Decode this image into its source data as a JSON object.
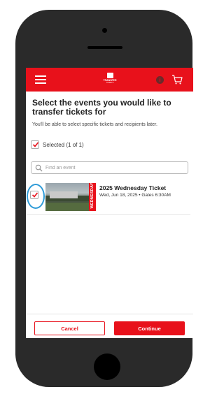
{
  "header": {
    "logo_line1": "TRANSFER",
    "logo_line2": "TICKETS"
  },
  "page": {
    "title": "Select the events you would like to transfer tickets for",
    "subtitle": "You'll be able to select specific tickets and recipients later."
  },
  "selection": {
    "label": "Selected (1 of 1)",
    "checked": true
  },
  "search": {
    "placeholder": "Find an event"
  },
  "events": [
    {
      "name": "2025 Wednesday Ticket",
      "date": "Wed, Jun 18, 2025 • Gates 6:30AM",
      "ribbon": "WEDNESDAY",
      "checked": true
    }
  ],
  "footer": {
    "cancel_label": "Cancel",
    "continue_label": "Continue"
  },
  "colors": {
    "brand": "#e8111b",
    "highlight": "#2e9bd8"
  }
}
